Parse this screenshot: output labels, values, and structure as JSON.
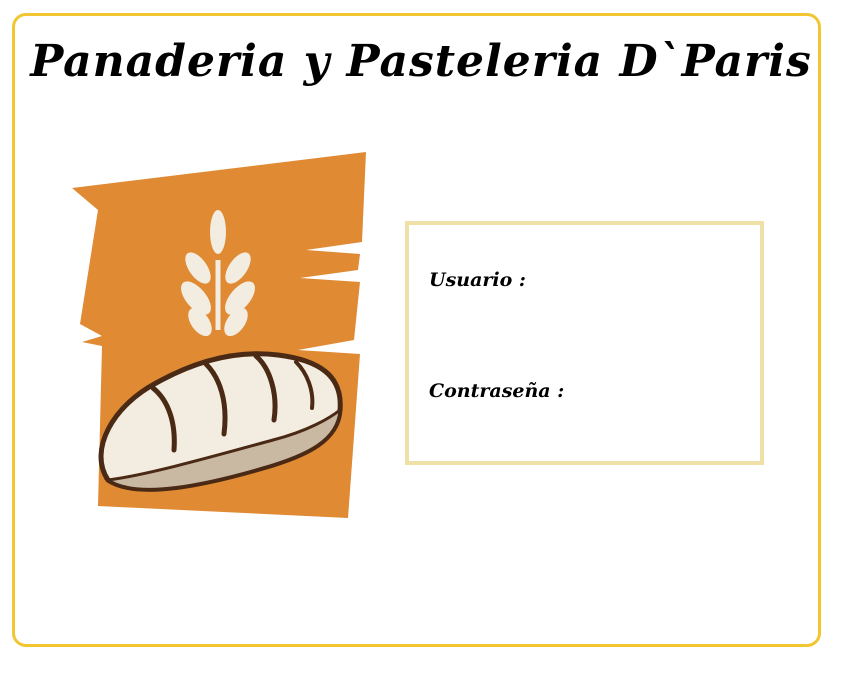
{
  "app": {
    "title": "Panaderia y Pasteleria D`Paris"
  },
  "logo": {
    "icon": "bread-and-wheat-icon",
    "background_color": "#e08a33",
    "bread_color": "#f3ece0",
    "outline_color": "#4a2a14"
  },
  "login": {
    "user_label": "Usuario :",
    "user_value": "",
    "password_label": "Contraseña :",
    "password_value": ""
  },
  "colors": {
    "frame_border": "#f2c631",
    "panel_border": "#efe0a8"
  }
}
